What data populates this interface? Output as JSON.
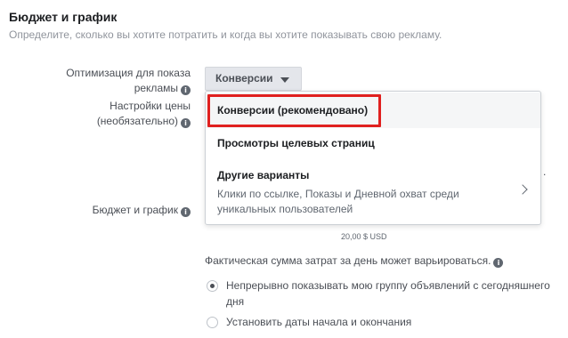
{
  "section": {
    "title": "Бюджет и график",
    "subtitle": "Определите, сколько вы хотите потратить и когда вы хотите показывать свою рекламу."
  },
  "optimization": {
    "label_line1": "Оптимизация для показа",
    "label_line2": "рекламы",
    "selected": "Конверсии"
  },
  "price_settings": {
    "label_line1": "Настройки цены",
    "label_line2": "(необязательно)"
  },
  "dropdown_menu": {
    "items": [
      {
        "label": "Конверсии (рекомендовано)"
      },
      {
        "label": "Просмотры целевых страниц"
      },
      {
        "label": "Другие варианты",
        "description": "Клики по ссылке, Показы и Дневной охват среди уникальных пользователей"
      }
    ]
  },
  "occluded_text_fragment": ".",
  "budget": {
    "label": "Бюджет и график",
    "amount": "20,00 $ USD",
    "spend_note": "Фактическая сумма затрат за день может варьироваться."
  },
  "schedule": {
    "options": [
      {
        "label": "Непрерывно показывать мою группу объявлений с сегодняшнего дня",
        "checked": true
      },
      {
        "label": "Установить даты начала и окончания",
        "checked": false
      }
    ]
  },
  "icons": {
    "info": "info-icon",
    "caret": "caret-down-icon",
    "chevron": "chevron-right-icon"
  },
  "colors": {
    "highlight": "#e0201f",
    "button_bg": "#e4e6eb",
    "hover_bg": "#f5f6f7"
  }
}
